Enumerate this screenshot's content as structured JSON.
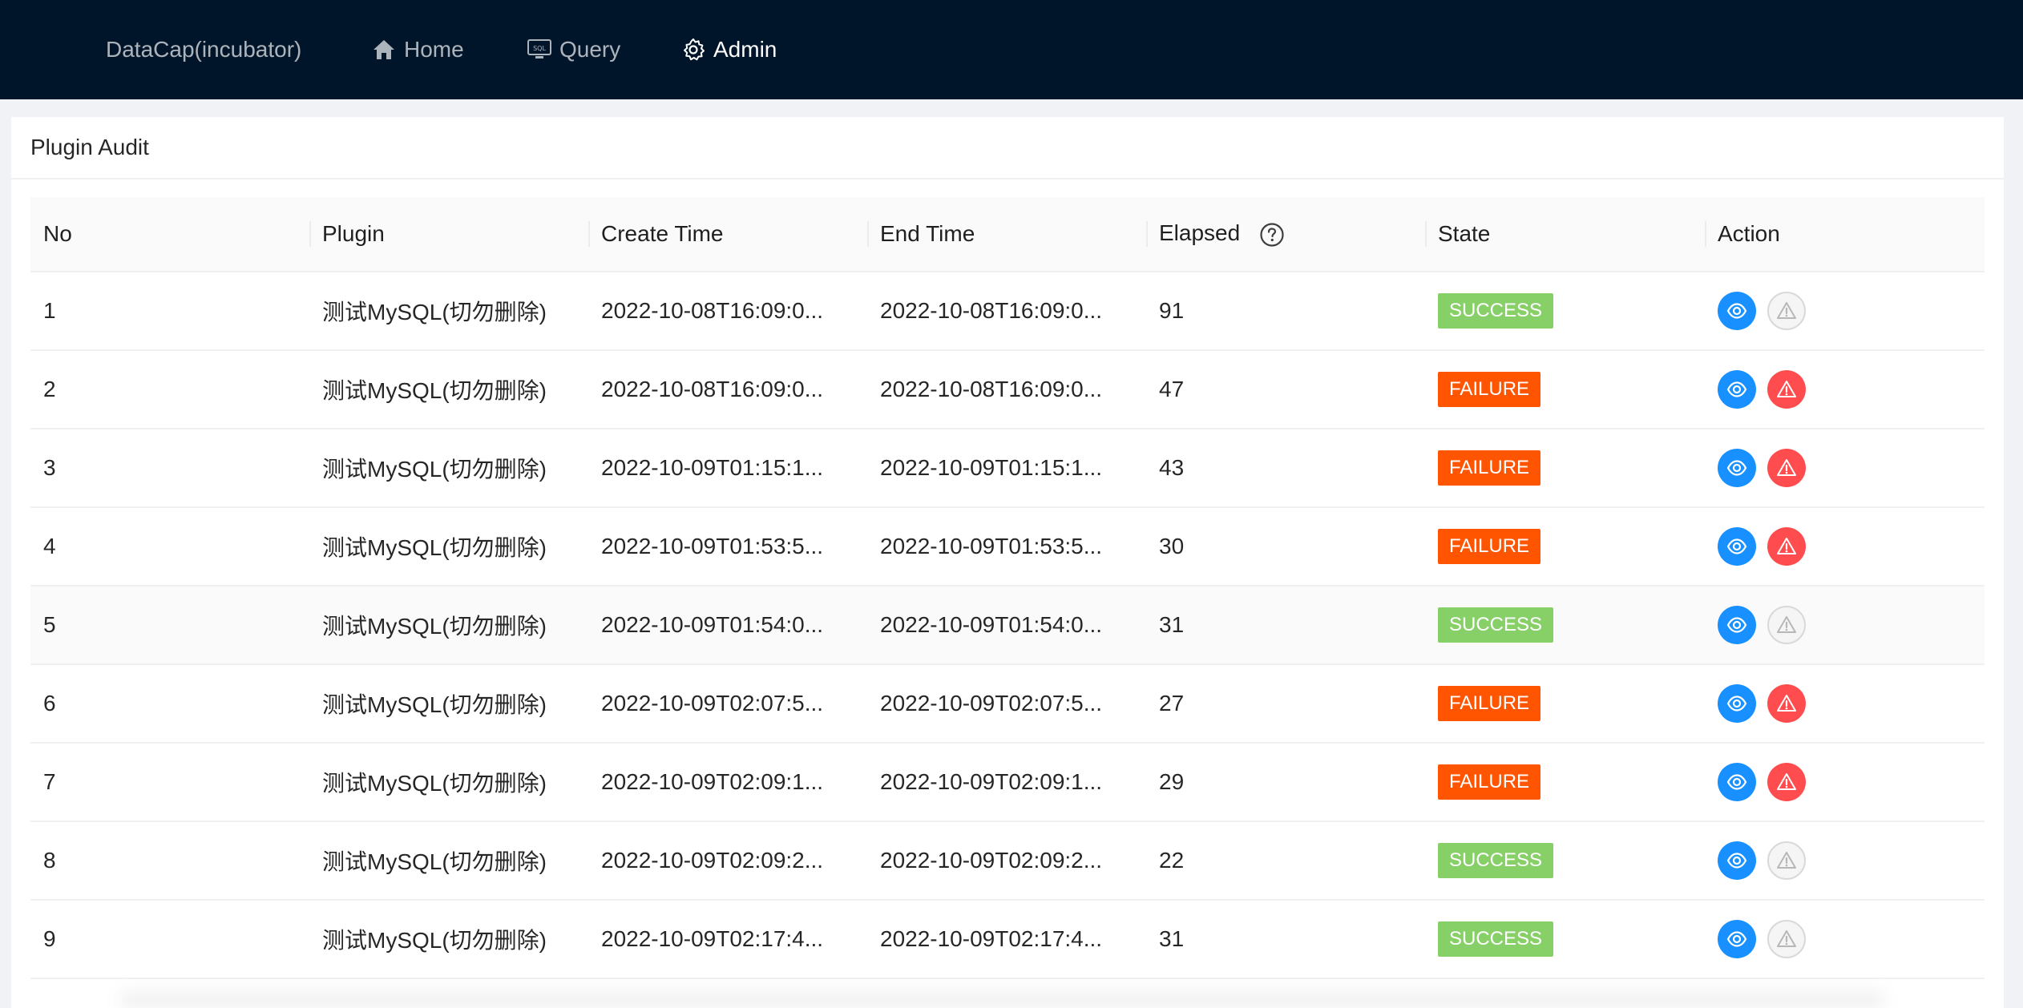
{
  "nav": {
    "brand": "DataCap(incubator)",
    "items": [
      {
        "label": "Home",
        "icon": "home-icon"
      },
      {
        "label": "Query",
        "icon": "sql-icon"
      },
      {
        "label": "Admin",
        "icon": "gear-icon",
        "active": true
      }
    ]
  },
  "page": {
    "title": "Plugin Audit"
  },
  "table": {
    "headers": {
      "no": "No",
      "plugin": "Plugin",
      "create_time": "Create Time",
      "end_time": "End Time",
      "elapsed": "Elapsed",
      "state": "State",
      "action": "Action"
    },
    "rows": [
      {
        "no": "1",
        "plugin": "测试MySQL(切勿删除)",
        "create_time": "2022-10-08T16:09:0...",
        "end_time": "2022-10-08T16:09:0...",
        "elapsed": "91",
        "state": "SUCCESS"
      },
      {
        "no": "2",
        "plugin": "测试MySQL(切勿删除)",
        "create_time": "2022-10-08T16:09:0...",
        "end_time": "2022-10-08T16:09:0...",
        "elapsed": "47",
        "state": "FAILURE"
      },
      {
        "no": "3",
        "plugin": "测试MySQL(切勿删除)",
        "create_time": "2022-10-09T01:15:1...",
        "end_time": "2022-10-09T01:15:1...",
        "elapsed": "43",
        "state": "FAILURE"
      },
      {
        "no": "4",
        "plugin": "测试MySQL(切勿删除)",
        "create_time": "2022-10-09T01:53:5...",
        "end_time": "2022-10-09T01:53:5...",
        "elapsed": "30",
        "state": "FAILURE"
      },
      {
        "no": "5",
        "plugin": "测试MySQL(切勿删除)",
        "create_time": "2022-10-09T01:54:0...",
        "end_time": "2022-10-09T01:54:0...",
        "elapsed": "31",
        "state": "SUCCESS"
      },
      {
        "no": "6",
        "plugin": "测试MySQL(切勿删除)",
        "create_time": "2022-10-09T02:07:5...",
        "end_time": "2022-10-09T02:07:5...",
        "elapsed": "27",
        "state": "FAILURE"
      },
      {
        "no": "7",
        "plugin": "测试MySQL(切勿删除)",
        "create_time": "2022-10-09T02:09:1...",
        "end_time": "2022-10-09T02:09:1...",
        "elapsed": "29",
        "state": "FAILURE"
      },
      {
        "no": "8",
        "plugin": "测试MySQL(切勿删除)",
        "create_time": "2022-10-09T02:09:2...",
        "end_time": "2022-10-09T02:09:2...",
        "elapsed": "22",
        "state": "SUCCESS"
      },
      {
        "no": "9",
        "plugin": "测试MySQL(切勿删除)",
        "create_time": "2022-10-09T02:17:4...",
        "end_time": "2022-10-09T02:17:4...",
        "elapsed": "31",
        "state": "SUCCESS"
      }
    ],
    "hover_row": 4
  },
  "colors": {
    "topbar": "#001529",
    "success": "#87d068",
    "failure": "#ff5500",
    "view_button": "#1890ff",
    "error_button": "#ff4d4f"
  }
}
